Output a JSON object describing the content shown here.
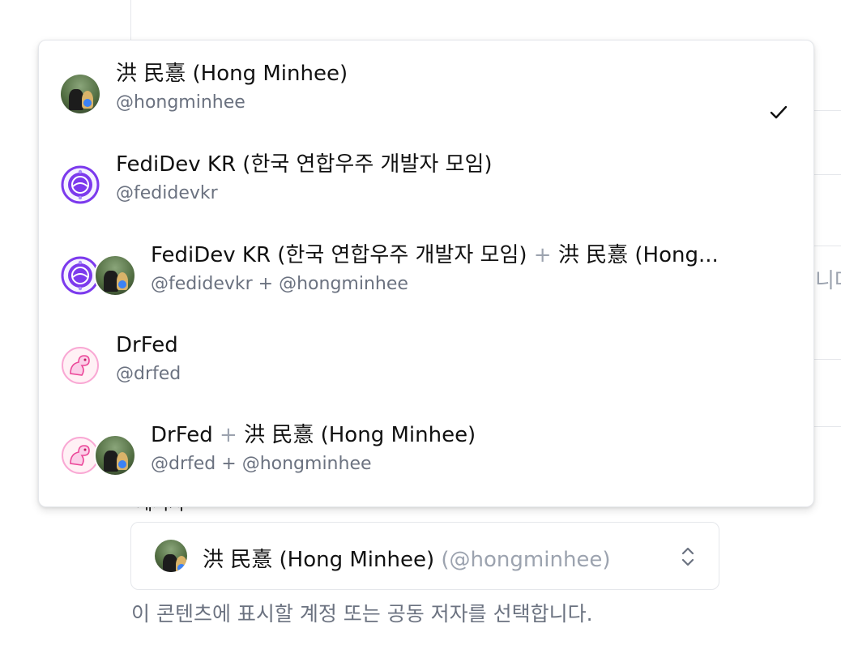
{
  "background": {
    "partial_text": "니다",
    "hidden_label": "게시자"
  },
  "menu": {
    "items": [
      {
        "name": "洪 民憙 (Hong Minhee)",
        "handle": "@hongminhee",
        "avatars": [
          "photo-avatar"
        ],
        "selected": true
      },
      {
        "name": "FediDev KR (한국 연합우주 개발자 모임)",
        "handle": "@fedidevkr",
        "avatars": [
          "fedidev-logo-avatar"
        ],
        "selected": false
      },
      {
        "name_a": "FediDev KR (한국 연합우주 개발자 모임)",
        "name_sep": "+",
        "name_b": "洪 民憙 (Hong...",
        "handle_a": "@fedidevkr",
        "handle_sep": "+",
        "handle_b": "@hongminhee",
        "avatars": [
          "fedidev-logo-avatar",
          "photo-avatar"
        ],
        "selected": false
      },
      {
        "name": "DrFed",
        "handle": "@drfed",
        "avatars": [
          "drfed-logo-avatar"
        ],
        "selected": false
      },
      {
        "name_a": "DrFed",
        "name_sep": "+",
        "name_b": "洪 民憙 (Hong Minhee)",
        "handle_a": "@drfed",
        "handle_sep": "+",
        "handle_b": "@hongminhee",
        "avatars": [
          "drfed-logo-avatar",
          "photo-avatar"
        ],
        "selected": false
      }
    ]
  },
  "select": {
    "value_name": "洪 民憙 (Hong Minhee)",
    "value_handle": "(@hongminhee)"
  },
  "help_text": "이 콘텐츠에 표시할 계정 또는 공동 저자를 선택합니다.",
  "colors": {
    "fedidev_purple": "#7c3aed",
    "drfed_pink": "#f472b6",
    "muted_text": "#6b7280",
    "border": "#e5e7eb"
  }
}
